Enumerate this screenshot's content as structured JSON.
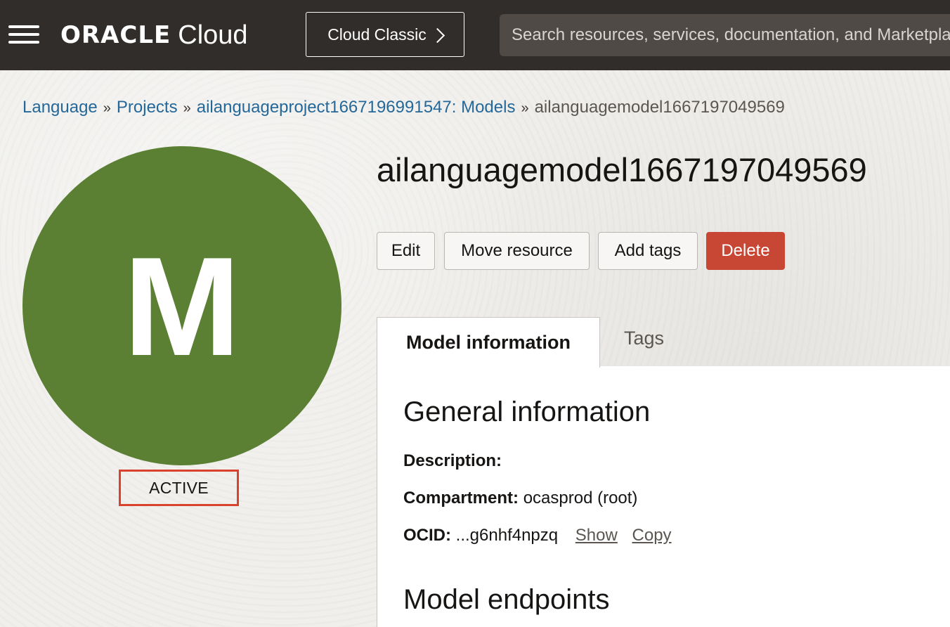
{
  "header": {
    "menu_icon": "hamburger-menu-icon",
    "logo_brand": "ORACLE",
    "logo_product": "Cloud",
    "classic_button_label": "Cloud Classic",
    "search_placeholder": "Search resources, services, documentation, and Marketplace"
  },
  "breadcrumb": {
    "items": [
      "Language",
      "Projects",
      "ailanguageproject1667196991547: Models"
    ],
    "separator": "»",
    "current": "ailanguagemodel1667197049569"
  },
  "resource": {
    "avatar_letter": "M",
    "avatar_color": "#5b8033",
    "status": "ACTIVE",
    "status_highlight_color": "#d9432e",
    "name": "ailanguagemodel1667197049569"
  },
  "actions": {
    "edit": "Edit",
    "move": "Move resource",
    "add_tags": "Add tags",
    "delete": "Delete",
    "delete_color": "#c74634"
  },
  "tabs": [
    {
      "label": "Model information",
      "active": true
    },
    {
      "label": "Tags",
      "active": false
    }
  ],
  "general_info": {
    "heading": "General information",
    "description_label": "Description:",
    "description_value": "",
    "compartment_label": "Compartment:",
    "compartment_value": "ocasprod (root)",
    "ocid_label": "OCID:",
    "ocid_value": "...g6nhf4npzq",
    "show_link": "Show",
    "copy_link": "Copy"
  },
  "endpoints": {
    "heading": "Model endpoints"
  }
}
